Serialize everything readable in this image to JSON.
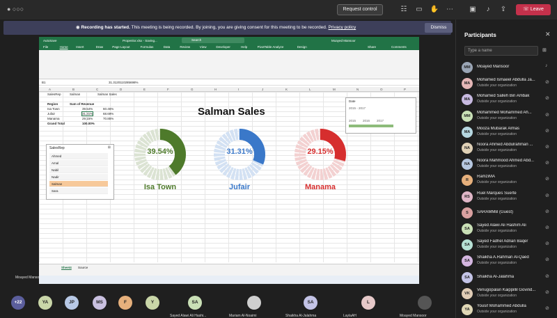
{
  "topbar": {
    "timer": "",
    "request_control": "Request control",
    "leave": "Leave",
    "icons": [
      "people-icon",
      "chat-icon",
      "raise-hand-icon",
      "more-icon",
      "camera-off-icon",
      "mic-off-icon",
      "share-icon"
    ]
  },
  "banner": {
    "bold": "Recording has started.",
    "text": " This meeting is being recorded. By joining, you are giving consent for this meeting to be recorded.",
    "link": "Privacy policy",
    "dismiss": "Dismiss"
  },
  "excel": {
    "autosave": "AutoSave",
    "filename": "Propenlor.xlsx - Saving...",
    "search": "Search",
    "user": "Moayed Mansoor",
    "menu": [
      "File",
      "Home",
      "Insert",
      "Draw",
      "Page Layout",
      "Formulas",
      "Data",
      "Review",
      "View",
      "Developer",
      "Help",
      "PivotTable Analyze",
      "Design"
    ],
    "share": "Share",
    "comments": "Comments",
    "name_box": "B1",
    "formula_value": "31.3120110285698%",
    "columns": [
      "A",
      "B",
      "C",
      "D",
      "E",
      "F",
      "G",
      "H",
      "I",
      "J",
      "K",
      "L",
      "M",
      "N",
      "O",
      "P"
    ],
    "filters": [
      "SalesRep",
      "Salman",
      "Salman Sales"
    ],
    "pivot": {
      "header_region": "Region",
      "header_sum": "Sum of Revenue",
      "rows": [
        {
          "region": "Isa Town",
          "value": "39.54%",
          "c": "60.46%"
        },
        {
          "region": "Jufair",
          "value": "31.31%",
          "c": "68.69%"
        },
        {
          "region": "Manama",
          "value": "29.15%",
          "c": "70.85%"
        }
      ],
      "total_label": "Grand Total",
      "total_value": "100.00%"
    },
    "dashboard_title": "Salman Sales",
    "donuts": [
      {
        "label": "39.54%",
        "region": "Isa Town",
        "value": 39.54,
        "color": "#4e7a2b",
        "light": "#dbe3d3"
      },
      {
        "label": "31.31%",
        "region": "Jufair",
        "value": 31.31,
        "color": "#3a78c9",
        "light": "#d3e1f3"
      },
      {
        "label": "29.15%",
        "region": "Manama",
        "value": 29.15,
        "color": "#d62e2e",
        "light": "#f3d1d1"
      }
    ],
    "slicer": {
      "title": "SalesRep",
      "items": [
        "Ahmed",
        "Amal",
        "Nabil",
        "Nadir",
        "Salman",
        "Sara"
      ],
      "selected": "Salman"
    },
    "timeline": {
      "title": "Date",
      "range": "2015 - 2017",
      "years": [
        "2015",
        "2016",
        "2017"
      ]
    },
    "sheet_tabs": [
      "Sheet4",
      "Source"
    ]
  },
  "presenter": "Moayed Mansoor",
  "panel": {
    "title": "Participants",
    "search_placeholder": "Type a name",
    "participants": [
      {
        "name": "Moayed Mansoor",
        "sub": "",
        "initials": "MM",
        "color": "#9aa5b5"
      },
      {
        "name": "Mohamed Ismaeel Abdulla Ja...",
        "sub": "Outside your organization",
        "initials": "MA",
        "color": "#e4b6b6"
      },
      {
        "name": "Mohamed Salleh Bin Ambak",
        "sub": "Outside your organization",
        "initials": "MA",
        "color": "#c7b9e0"
      },
      {
        "name": "Mohammed Mohammed Ah...",
        "sub": "Outside your organization",
        "initials": "MM",
        "color": "#c8e0b6"
      },
      {
        "name": "Mooza Mubarak Almas",
        "sub": "Outside your organization",
        "initials": "MA",
        "color": "#b6d7e0"
      },
      {
        "name": "Noora Ahmed Abdulrahman ...",
        "sub": "Outside your organization",
        "initials": "NA",
        "color": "#e0d1b6"
      },
      {
        "name": "Noora Mahmood Ahmed Abd...",
        "sub": "Outside your organization",
        "initials": "NA",
        "color": "#b6c7e0"
      },
      {
        "name": "RamziMA",
        "sub": "Outside your organization",
        "initials": "R",
        "color": "#e6b07c"
      },
      {
        "name": "Ruel Marques Suerte",
        "sub": "Outside your organization",
        "initials": "RS",
        "color": "#e0b6c7"
      },
      {
        "name": "SARAMMB (Guest)",
        "sub": "",
        "initials": "S",
        "color": "#d9a0a0"
      },
      {
        "name": "Sayed Alawi Ali Hashim Ali",
        "sub": "Outside your organization",
        "initials": "SA",
        "color": "#c9e0b6"
      },
      {
        "name": "Sayed Fadhel Adnan Baqer",
        "sub": "Outside your organization",
        "initials": "SA",
        "color": "#b6e0d4"
      },
      {
        "name": "Shaikha A.Rahman Al-Qaed",
        "sub": "Outside your organization",
        "initials": "SA",
        "color": "#d4b6e0"
      },
      {
        "name": "Shaikha Al-Jalahma",
        "sub": "",
        "initials": "SA",
        "color": "#c3c3e6"
      },
      {
        "name": "Venugopalan Kaippillil Govind...",
        "sub": "Outside your organization",
        "initials": "VK",
        "color": "#e0ccb6"
      },
      {
        "name": "Yousif Mohammed Abdulla",
        "sub": "Outside your organization",
        "initials": "YA",
        "color": "#e0d8b6"
      }
    ]
  },
  "gallery": {
    "more": "+22",
    "avatars": [
      {
        "initials": "YA",
        "color": "#c9d6a8"
      },
      {
        "initials": "JP",
        "color": "#b8c9e6"
      },
      {
        "initials": "MS",
        "color": "#c9c0e0"
      },
      {
        "initials": "F",
        "color": "#e6b07c"
      },
      {
        "initials": "Y",
        "color": "#c9d6a8"
      },
      {
        "initials": "SA",
        "color": "#c9e0b6",
        "name": "Sayed Alawi Ali Hashi..."
      },
      {
        "initials": "",
        "color": "#cfcfcf",
        "name": "Mariam Al-Noaimi"
      },
      {
        "initials": "SA",
        "color": "#c3c3e6",
        "name": "Shaikha Al-Jalahma"
      },
      {
        "initials": "L",
        "color": "#e6c9c9",
        "name": "LaylaAH"
      },
      {
        "initials": "",
        "color": "#555",
        "name": "Moayed Mansoor"
      }
    ]
  }
}
